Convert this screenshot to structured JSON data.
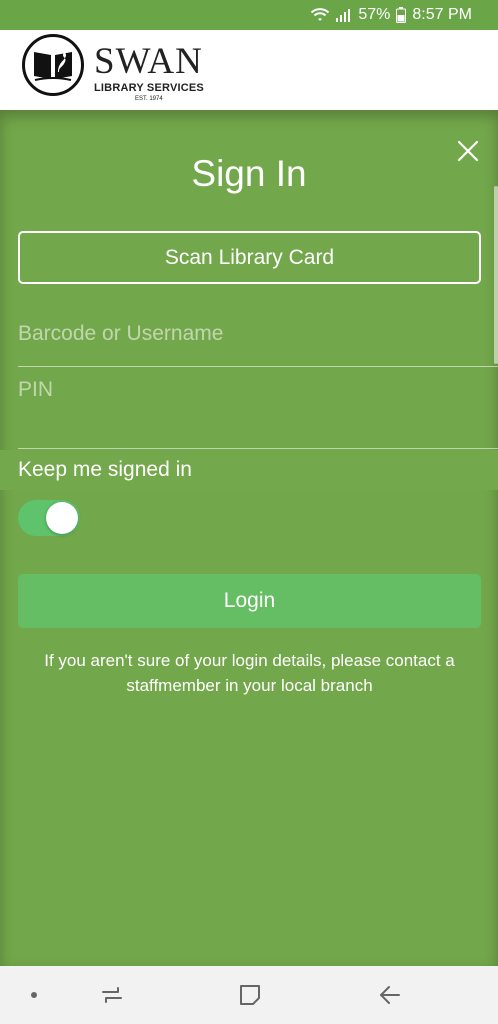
{
  "status_bar": {
    "battery_percent": "57%",
    "time": "8:57 PM",
    "icons": [
      "wifi-icon",
      "signal-icon",
      "battery-icon"
    ]
  },
  "header": {
    "logo_title": "SWAN",
    "logo_subtitle": "LIBRARY SERVICES",
    "logo_est": "EST. 1974"
  },
  "signin": {
    "title": "Sign In",
    "close_icon": "close-icon",
    "scan_button": "Scan Library Card",
    "username_placeholder": "Barcode or Username",
    "username_value": "",
    "pin_placeholder": "PIN",
    "pin_value": "",
    "keep_signed_in_label": "Keep me signed in",
    "keep_signed_in": true,
    "login_button": "Login",
    "help_text": "If you aren't sure of your login details, please contact a staffmember in your local branch"
  },
  "nav_bar": {
    "icons": [
      "dot-icon",
      "recent-apps-icon",
      "home-icon",
      "back-icon"
    ]
  },
  "colors": {
    "background_green": "#74a84c",
    "toggle_on": "#5ec36b",
    "login_button": "#65bd64",
    "nav_bar": "#f2f2f2"
  }
}
